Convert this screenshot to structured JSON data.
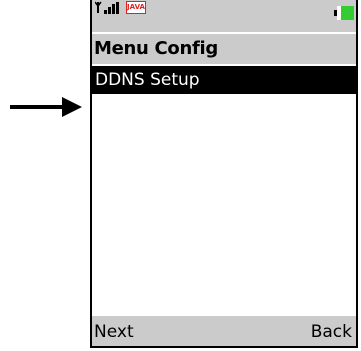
{
  "status_bar": {
    "java_badge": "JAVA",
    "icons": [
      "signal-icon",
      "java-icon",
      "battery-icon"
    ],
    "battery_color": "#33cc33"
  },
  "header": {
    "title": "Menu Config"
  },
  "menu": {
    "items": [
      {
        "label": "DDNS Setup",
        "selected": true
      }
    ]
  },
  "softkeys": {
    "left_label": "Next",
    "right_label": "Back"
  },
  "colors": {
    "bar_gray": "#cbcbcb",
    "selection": "#000000",
    "selection_text": "#ffffff"
  }
}
